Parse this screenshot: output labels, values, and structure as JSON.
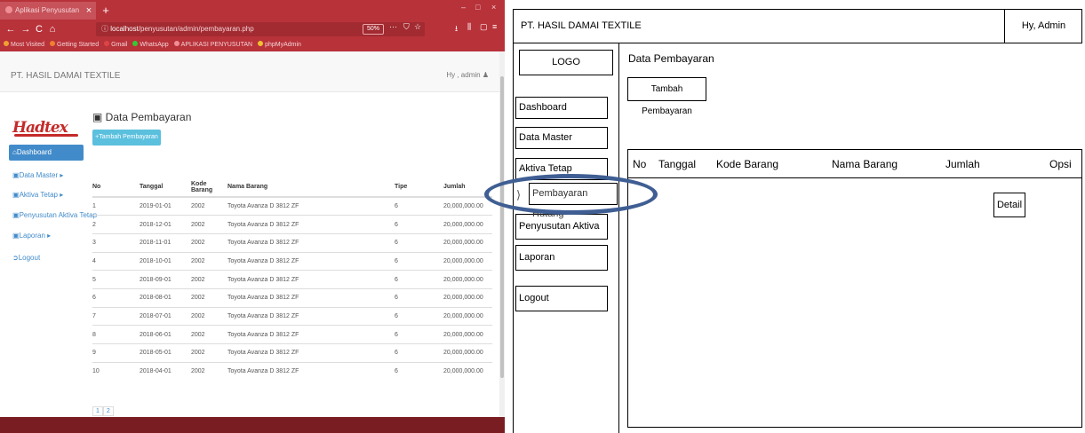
{
  "browser": {
    "tab_title": "Aplikasi Penyusutan",
    "tab_close": "×",
    "new_tab": "+",
    "window_controls": [
      "–",
      "□",
      "×"
    ],
    "nav": {
      "back": "←",
      "forward": "→",
      "reload": "C",
      "home": "⌂"
    },
    "url_host": "localhost",
    "url_path": "/penyusutan/admin/pembayaran.php",
    "zoom": "50%",
    "url_icons": [
      "···",
      "⛉",
      "☆"
    ],
    "toolbar_icons": [
      "⭳",
      "⫼",
      "▢",
      "≡"
    ],
    "bookmarks": [
      "Most Visited",
      "Getting Started",
      "Gmail",
      "WhatsApp",
      "APLIKASI PENYUSUTAN",
      "phpMyAdmin"
    ],
    "bookmark_colors": [
      "#f0a030",
      "#f08030",
      "#d44",
      "#3c3",
      "#f08e95",
      "#f0c030"
    ]
  },
  "app": {
    "brand": "PT. HASIL DAMAI TEXTILE",
    "user": "Hy , admin",
    "logo_text": "Hadtex",
    "page_title": "Data Pembayaran",
    "add_button": "+Tambah Pembayaran",
    "sidebar": [
      {
        "label": "Dashboard",
        "active": true
      },
      {
        "label": "Data Master ▸",
        "active": false
      },
      {
        "label": "Aktiva Tetap ▸",
        "active": false
      },
      {
        "label": "Penyusutan Aktiva Tetap",
        "active": false
      },
      {
        "label": "Laporan ▸",
        "active": false
      },
      {
        "label": "Logout",
        "active": false
      }
    ],
    "table_headers": [
      "No",
      "Tanggal",
      "Kode Barang",
      "Nama Barang",
      "Tipe",
      "Jumlah"
    ],
    "table_rows": [
      [
        "1",
        "2019-01-01",
        "2002",
        "Toyota Avanza D 3812 ZF",
        "6",
        "20,000,000.00"
      ],
      [
        "2",
        "2018-12-01",
        "2002",
        "Toyota Avanza D 3812 ZF",
        "6",
        "20,000,000.00"
      ],
      [
        "3",
        "2018-11-01",
        "2002",
        "Toyota Avanza D 3812 ZF",
        "6",
        "20,000,000.00"
      ],
      [
        "4",
        "2018-10-01",
        "2002",
        "Toyota Avanza D 3812 ZF",
        "6",
        "20,000,000.00"
      ],
      [
        "5",
        "2018-09-01",
        "2002",
        "Toyota Avanza D 3812 ZF",
        "6",
        "20,000,000.00"
      ],
      [
        "6",
        "2018-08-01",
        "2002",
        "Toyota Avanza D 3812 ZF",
        "6",
        "20,000,000.00"
      ],
      [
        "7",
        "2018-07-01",
        "2002",
        "Toyota Avanza D 3812 ZF",
        "6",
        "20,000,000.00"
      ],
      [
        "8",
        "2018-06-01",
        "2002",
        "Toyota Avanza D 3812 ZF",
        "6",
        "20,000,000.00"
      ],
      [
        "9",
        "2018-05-01",
        "2002",
        "Toyota Avanza D 3812 ZF",
        "6",
        "20,000,000.00"
      ],
      [
        "10",
        "2018-04-01",
        "2002",
        "Toyota Avanza D 3812 ZF",
        "6",
        "20,000,000.00"
      ]
    ],
    "pages": [
      "1",
      "2"
    ],
    "accent_color": "#428bca",
    "add_button_color": "#5bc0de",
    "browser_chrome_color": "#b8323a"
  },
  "mockup": {
    "brand": "PT. HASIL DAMAI TEXTILE",
    "user": "Hy, Admin",
    "logo": "LOGO",
    "sidebar": [
      "Dashboard",
      "Data Master",
      "Aktiva Tetap",
      "Penyusutan Aktiva Tetap",
      "Laporan",
      "Logout"
    ],
    "submenu_item": "Pembayaran Hutang",
    "page_title": "Data Pembayaran",
    "add_button": "Tambah Pembayaran",
    "table_headers": [
      "No",
      "Tanggal",
      "Kode Barang",
      "Nama Barang",
      "Jumlah",
      "Opsi"
    ],
    "detail_button": "Detail",
    "highlight_color": "#3f5e93"
  }
}
